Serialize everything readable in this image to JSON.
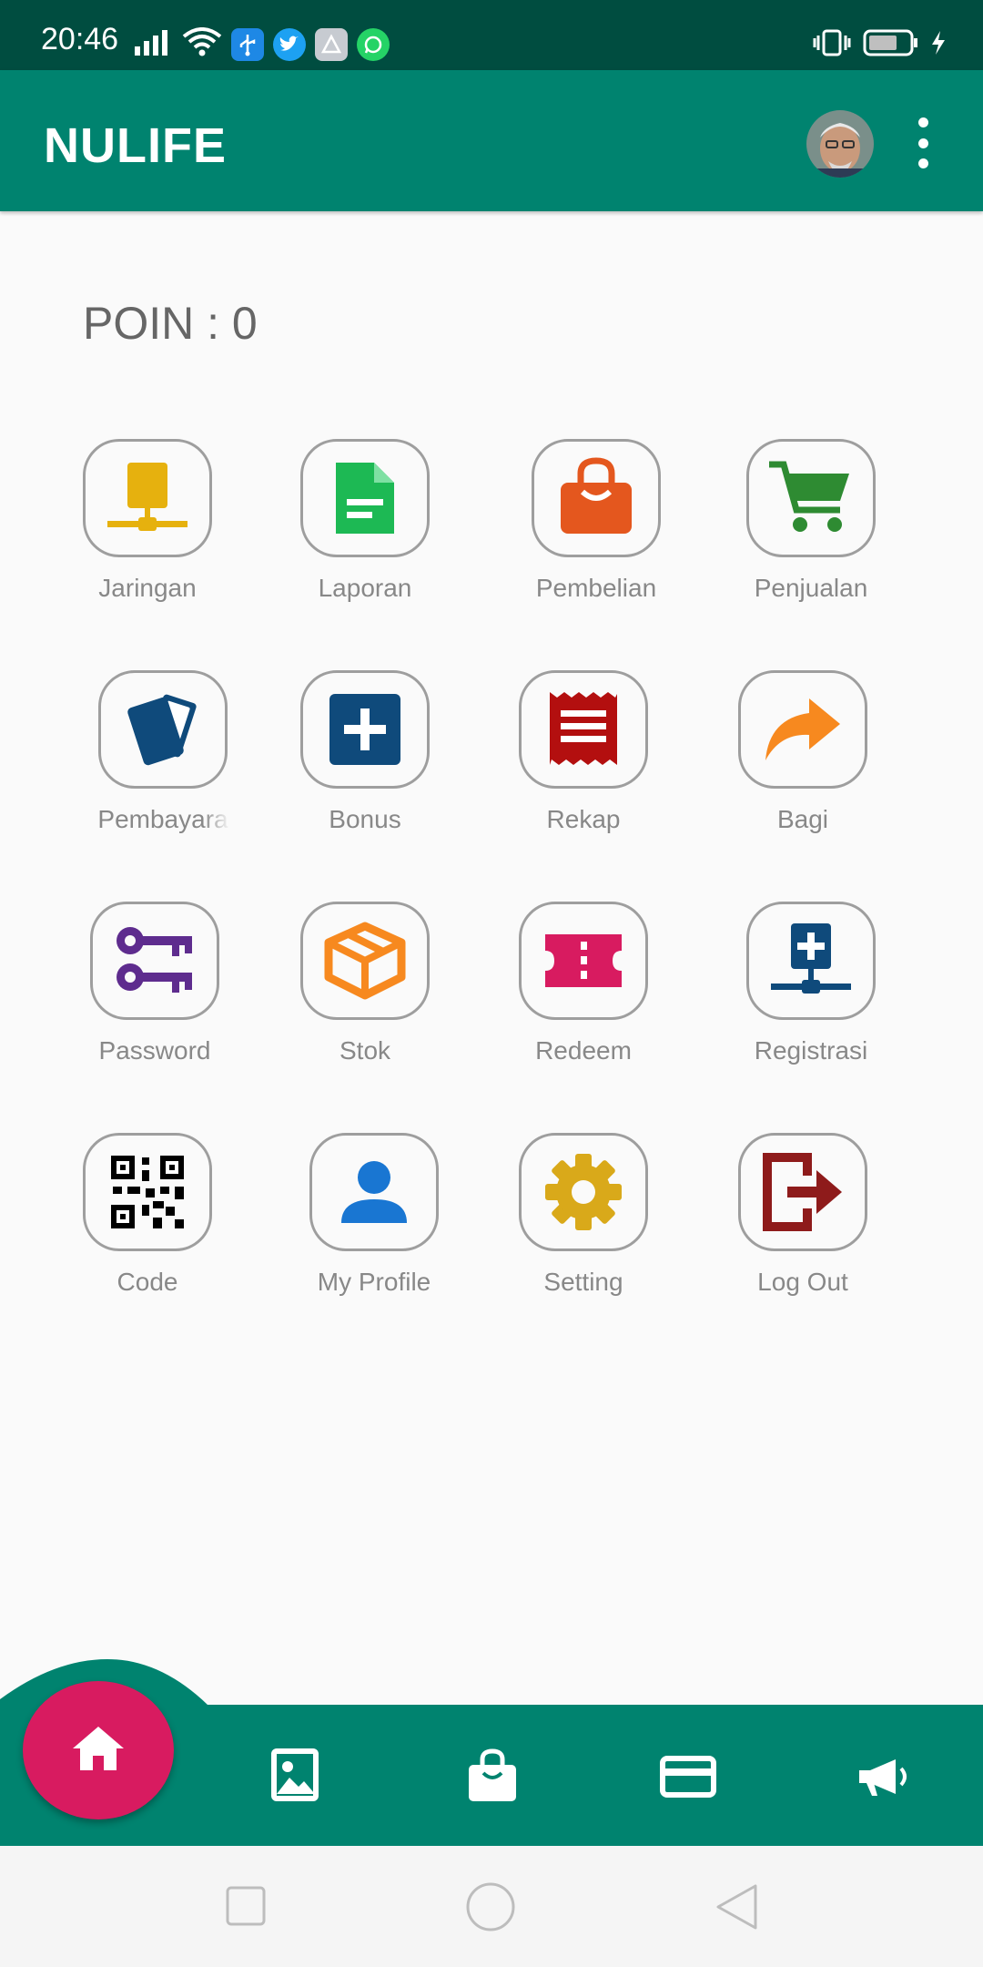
{
  "status_bar": {
    "time": "20:46",
    "left_icons": [
      "signal-icon",
      "wifi-icon",
      "usb-icon",
      "twitter-icon",
      "store-icon",
      "whatsapp-icon"
    ],
    "right_icons": [
      "vibrate-icon",
      "battery-icon",
      "charging-icon"
    ]
  },
  "app_bar": {
    "title": "NULIFE",
    "color": "#00836f"
  },
  "poin": "POIN : 0",
  "menu": [
    {
      "label": "Jaringan",
      "icon": "network-icon",
      "color": "#e6b10e"
    },
    {
      "label": "Laporan",
      "icon": "document-icon",
      "color": "#1db954"
    },
    {
      "label": "Pembelian",
      "icon": "shopping-bag-icon",
      "color": "#e4571e"
    },
    {
      "label": "Penjualan",
      "icon": "cart-icon",
      "color": "#2e8b32"
    },
    {
      "label": "Pembayara",
      "icon": "cards-icon",
      "color": "#0f4a7b"
    },
    {
      "label": "Bonus",
      "icon": "plus-box-icon",
      "color": "#0f4a7b"
    },
    {
      "label": "Rekap",
      "icon": "receipt-icon",
      "color": "#b30f0f"
    },
    {
      "label": "Bagi",
      "icon": "share-arrow-icon",
      "color": "#f7891f"
    },
    {
      "label": "Password",
      "icon": "keys-icon",
      "color": "#5e2c8e"
    },
    {
      "label": "Stok",
      "icon": "box-icon",
      "color": "#f7891f"
    },
    {
      "label": "Redeem",
      "icon": "ticket-icon",
      "color": "#d81b60"
    },
    {
      "label": "Registrasi",
      "icon": "network-add-icon",
      "color": "#0f4a7b"
    },
    {
      "label": "Code",
      "icon": "qr-code-icon",
      "color": "#000000"
    },
    {
      "label": "My Profile",
      "icon": "person-icon",
      "color": "#1976d2"
    },
    {
      "label": "Setting",
      "icon": "gear-icon",
      "color": "#d9a91a"
    },
    {
      "label": "Log Out",
      "icon": "logout-icon",
      "color": "#8e1b1b"
    }
  ],
  "bottom_nav": {
    "items": [
      "home-icon",
      "gallery-icon",
      "bag-icon",
      "card-icon",
      "megaphone-icon"
    ],
    "active": "home-icon",
    "fab_color": "#d81b60"
  },
  "system_nav": [
    "recents-button",
    "home-button",
    "back-button"
  ]
}
